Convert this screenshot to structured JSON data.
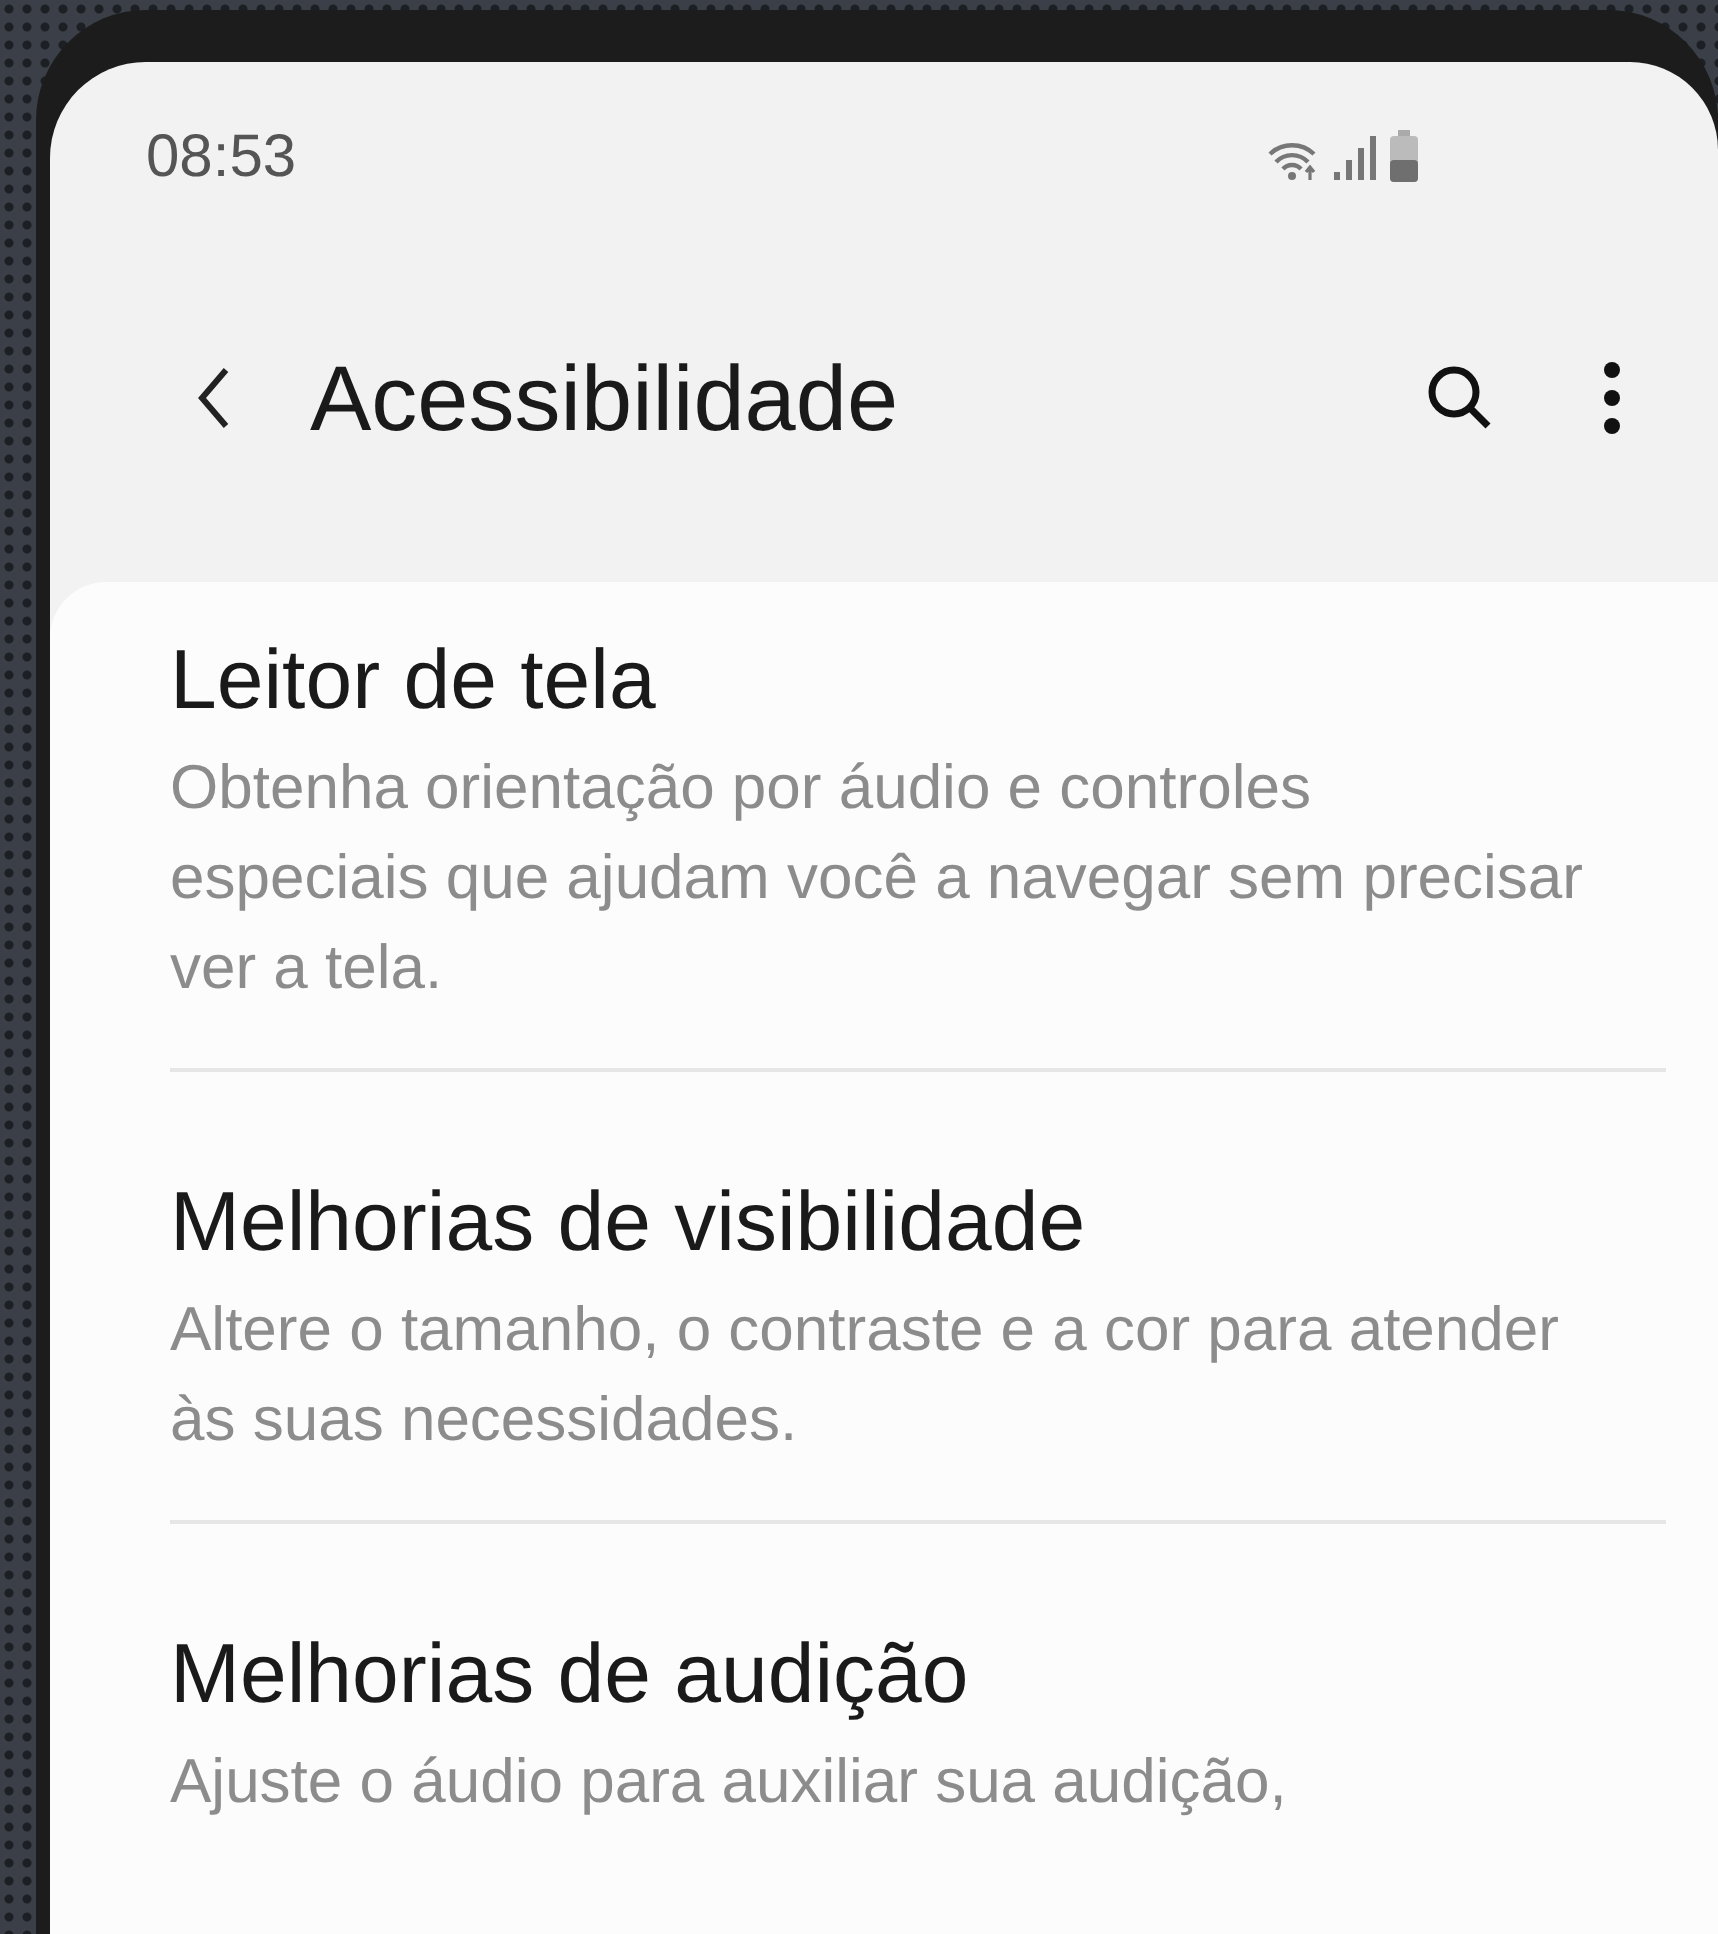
{
  "status_bar": {
    "time": "08:53"
  },
  "header": {
    "title": "Acessibilidade"
  },
  "items": [
    {
      "title": "Leitor de tela",
      "description": "Obtenha orientação por áudio e controles especiais que ajudam você a navegar sem precisar ver a tela."
    },
    {
      "title": "Melhorias de visibilidade",
      "description": "Altere o tamanho, o contraste e a cor para atender às suas necessidades."
    },
    {
      "title": "Melhorias de audição",
      "description": "Ajuste o áudio para auxiliar sua audição,"
    }
  ]
}
